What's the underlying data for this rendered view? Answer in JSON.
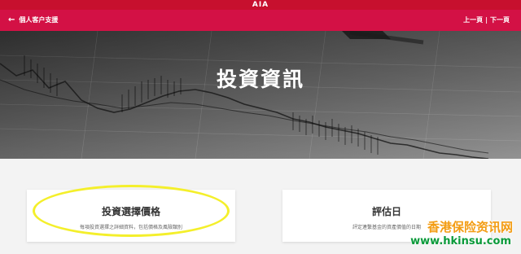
{
  "app": {
    "brand": "AIA"
  },
  "nav": {
    "back_label": "個人客户支援",
    "prev_label": "上一頁",
    "separator": "|",
    "next_label": "下一頁"
  },
  "hero": {
    "title": "投資資訊"
  },
  "cards": [
    {
      "title": "投資選擇價格",
      "description": "每項投資選擇之詳細資料，包括價格及風險類別"
    },
    {
      "title": "評估日",
      "description": "評定連繫基金的資產價值的日期"
    }
  ],
  "watermark": {
    "line1": "香港保险资讯网",
    "line2": "www.hkinsu.com"
  },
  "colors": {
    "topbar": "#c7102e",
    "navbar": "#d31145",
    "highlight": "#f4ef2b"
  }
}
